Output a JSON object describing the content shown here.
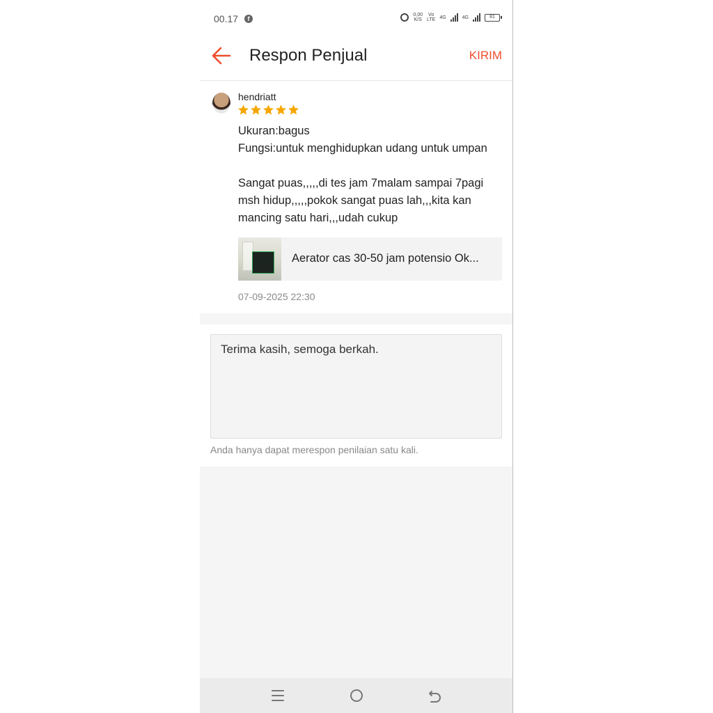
{
  "status_bar": {
    "time": "00.17",
    "app_icon": "facebook-icon",
    "net_speed_value": "0,00",
    "net_speed_unit": "K/S",
    "volte_top": "Vo",
    "volte_bottom": "LTE",
    "signal1_label": "4G",
    "signal2_label": "4G",
    "battery": "81"
  },
  "header": {
    "back_icon": "back-arrow-icon",
    "title": "Respon Penjual",
    "send_label": "KIRIM"
  },
  "review": {
    "reviewer": "hendriatt",
    "rating": 5,
    "text": "Ukuran:bagus\nFungsi:untuk menghidupkan udang untuk umpan\n\nSangat puas,,,,,di tes jam 7malam sampai 7pagi msh hidup,,,,,pokok sangat puas lah,,,kita kan mancing satu hari,,,udah cukup",
    "product_name": "Aerator cas 30-50 jam potensio Ok...",
    "date": "07-09-2025 22:30"
  },
  "response": {
    "value": "Terima kasih, semoga berkah.",
    "hint": "Anda hanya dapat merespon penilaian satu kali."
  },
  "nav": {
    "menu_icon": "menu-icon",
    "home_icon": "home-icon",
    "back_icon": "back-icon"
  },
  "colors": {
    "accent": "#ee4d2d",
    "star": "#f6a700",
    "background": "#f5f5f5"
  }
}
